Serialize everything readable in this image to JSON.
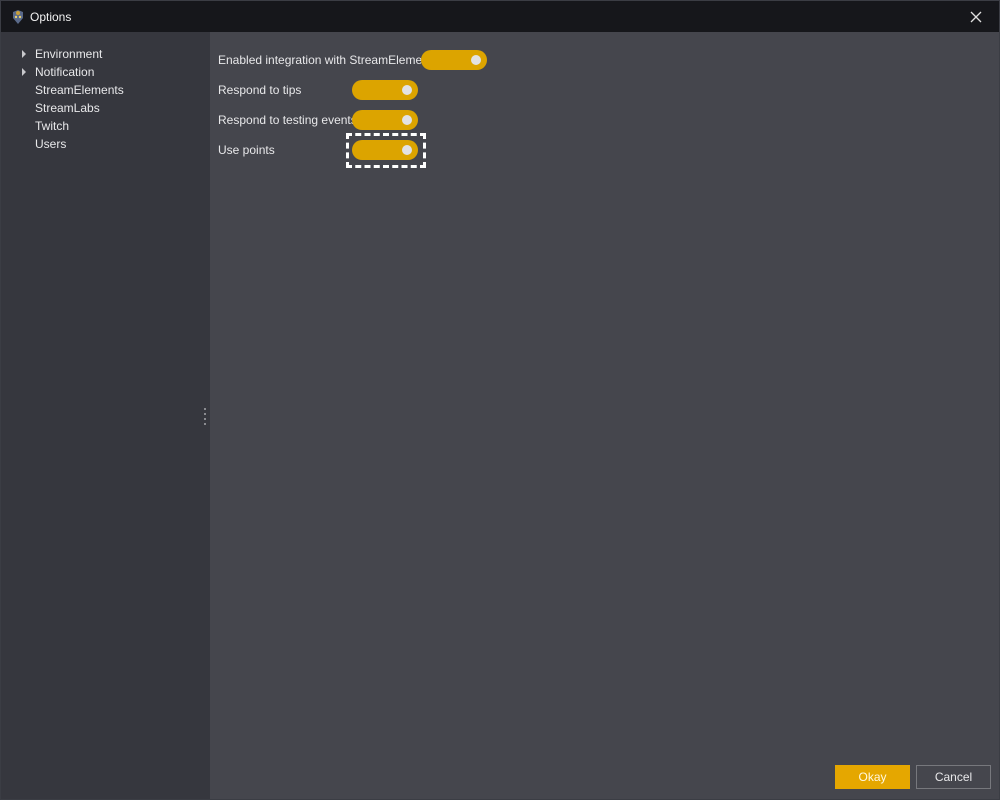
{
  "window": {
    "title": "Options",
    "app_icon": "app-logo-icon",
    "close_icon": "close-icon"
  },
  "sidebar": {
    "items": [
      {
        "label": "Environment",
        "expandable": true
      },
      {
        "label": "Notification",
        "expandable": true
      },
      {
        "label": "StreamElements",
        "expandable": false
      },
      {
        "label": "StreamLabs",
        "expandable": false
      },
      {
        "label": "Twitch",
        "expandable": false
      },
      {
        "label": "Users",
        "expandable": false
      }
    ]
  },
  "settings": {
    "rows": [
      {
        "label": "Enabled integration with StreamElements",
        "enabled": true
      },
      {
        "label": "Respond to tips",
        "enabled": true
      },
      {
        "label": "Respond to testing events",
        "enabled": true
      },
      {
        "label": "Use points",
        "enabled": true,
        "focused": true
      }
    ]
  },
  "colors": {
    "accent": "#dca400",
    "titlebar": "#16171b",
    "sidebar": "#36373e",
    "content": "#45464d"
  },
  "footer": {
    "okay_label": "Okay",
    "cancel_label": "Cancel"
  }
}
